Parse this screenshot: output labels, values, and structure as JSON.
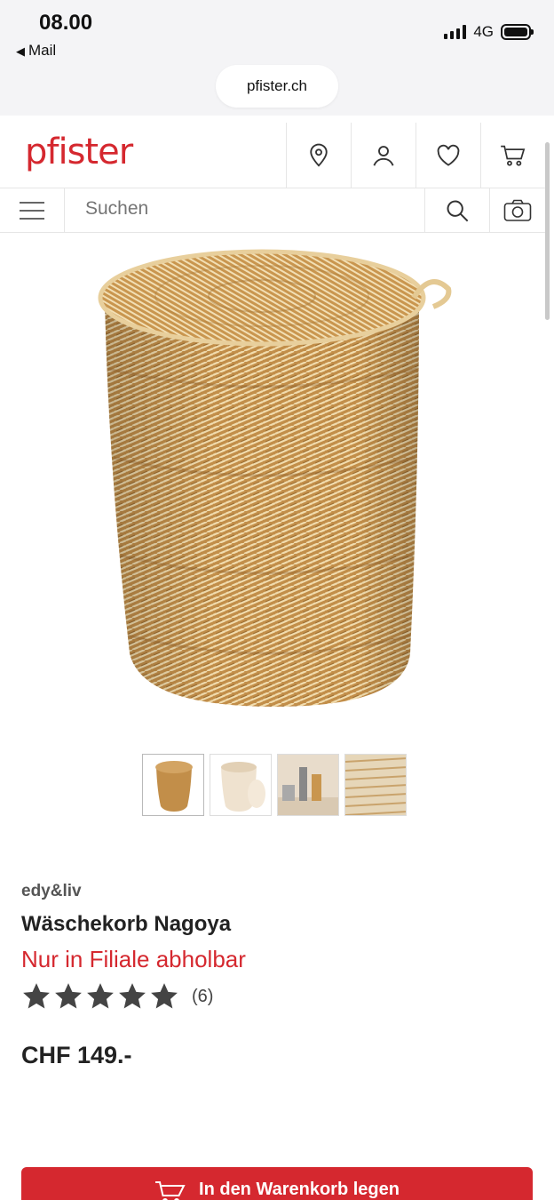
{
  "status_bar": {
    "time": "08.00",
    "back_app": "Mail",
    "network": "4G",
    "battery_level_percent": 100
  },
  "browser": {
    "url": "pfister.ch"
  },
  "header": {
    "logo": "pfister",
    "icons": [
      "location-pin-icon",
      "user-icon",
      "heart-icon",
      "cart-icon"
    ]
  },
  "search": {
    "placeholder": "Suchen",
    "icons": [
      "menu-icon",
      "search-icon",
      "camera-icon"
    ]
  },
  "gallery": {
    "thumbnail_count": 4,
    "active_index": 0
  },
  "product": {
    "brand": "edy&liv",
    "name": "Wäschekorb Nagoya",
    "availability": "Nur in Filiale abholbar",
    "rating": 5,
    "rating_max": 5,
    "rating_count": "(6)",
    "price": "CHF 149.-"
  },
  "cta": {
    "label": "In den Warenkorb legen"
  },
  "colors": {
    "brand_red": "#d5282f",
    "text_dark": "#222222",
    "star": "#444444",
    "basket": "#c9964f"
  }
}
